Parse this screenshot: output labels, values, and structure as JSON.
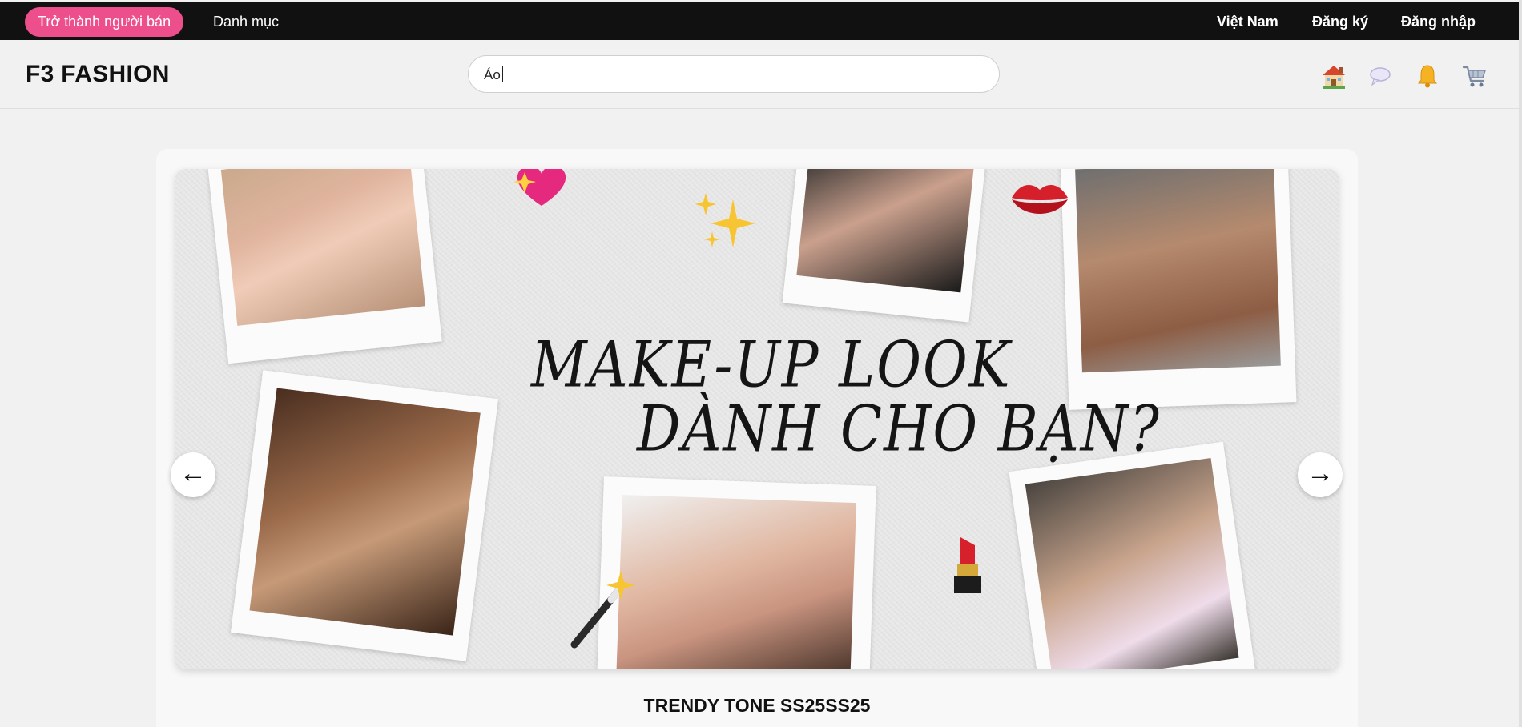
{
  "topbar": {
    "seller_button": "Trở thành người bán",
    "categories_link": "Danh mục",
    "country": "Việt Nam",
    "register": "Đăng ký",
    "login": "Đăng nhập"
  },
  "header": {
    "logo": "F3 FASHION",
    "search_value": "Áo",
    "icons": [
      "home-icon",
      "chat-icon",
      "bell-icon",
      "cart-icon"
    ]
  },
  "banner": {
    "headline_line1": "MAKE-UP LOOK",
    "headline_line2": "DÀNH CHO BẠN?",
    "prev_label": "←",
    "next_label": "→"
  },
  "section": {
    "title": "TRENDY TONE SS25SS25"
  },
  "colors": {
    "topbar_bg": "#111111",
    "seller_button_bg": "#ec4f8c",
    "page_bg": "#f1f1f1"
  }
}
